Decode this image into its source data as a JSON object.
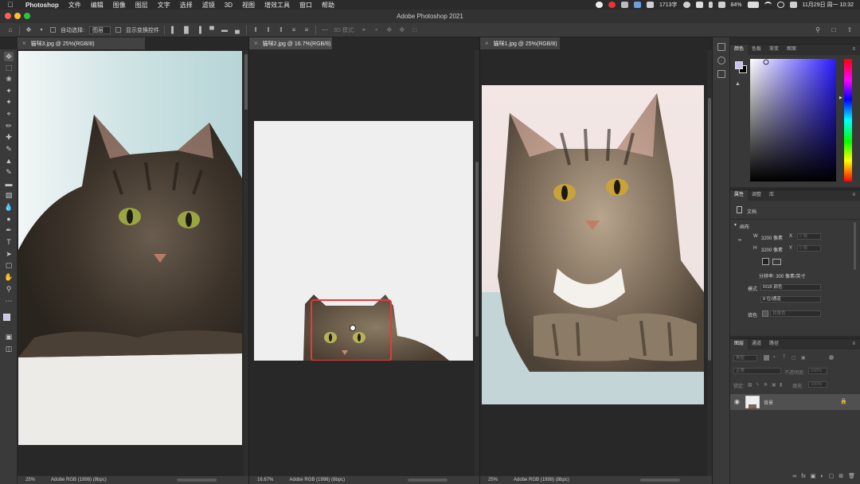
{
  "menubar": {
    "app": "Photoshop",
    "items": [
      "文件",
      "编辑",
      "图像",
      "图层",
      "文字",
      "选择",
      "滤镜",
      "3D",
      "视图",
      "增效工具",
      "窗口",
      "帮助"
    ],
    "word_count": "1713字",
    "battery": "84%",
    "clock": "11月29日 周一 10:32"
  },
  "window": {
    "title": "Adobe Photoshop 2021"
  },
  "options": {
    "auto_select_label": "自动选择:",
    "auto_select_value": "图层",
    "show_transform_label": "显示变换控件",
    "mode_3d_label": "3D 模式:"
  },
  "docs": [
    {
      "tab": "猫咪3.jpg @ 25%(RGB/8)",
      "zoom": "25%",
      "profile": "Adobe RGB (1998) (8bpc)"
    },
    {
      "tab": "猫咪2.jpg @ 16.7%(RGB/8)",
      "zoom": "16.67%",
      "profile": "Adobe RGB (1998) (8bpc)"
    },
    {
      "tab": "猫咪1.jpg @ 25%(RGB/8)",
      "zoom": "25%",
      "profile": "Adobe RGB (1998) (8bpc)"
    }
  ],
  "color_panel": {
    "tabs": [
      "颜色",
      "色板",
      "渐变",
      "图案"
    ],
    "fg": "#c9c3ef",
    "bg": "#000000"
  },
  "properties_panel": {
    "tabs": [
      "属性",
      "调整",
      "库"
    ],
    "doc_label": "文档",
    "canvas_label": "画布",
    "w_label": "W",
    "w_value": "3200 像素",
    "h_label": "H",
    "h_value": "3200 像素",
    "x_label": "X",
    "y_label": "Y",
    "x_value": "0 像",
    "y_value": "0 像",
    "resolution": "分辨率: 300 像素/英寸",
    "mode_label": "模式",
    "mode_value": "RGB 颜色",
    "depth_value": "8 位/通道",
    "fill_label": "填色",
    "fill_value": "背景色"
  },
  "layers_panel": {
    "tabs": [
      "图层",
      "通道",
      "路径"
    ],
    "filter_label": "类型",
    "blend_mode": "正常",
    "opacity_label": "不透明度:",
    "opacity_value": "100%",
    "lock_label": "锁定:",
    "fill_label": "填充:",
    "fill_value": "100%",
    "layer_name": "背景"
  },
  "accent_red": "#e23b3b"
}
